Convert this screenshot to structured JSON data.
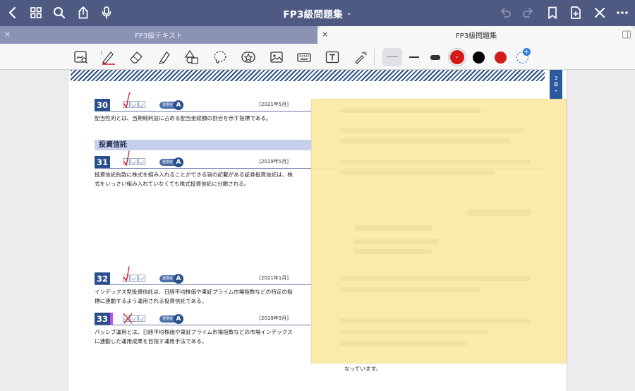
{
  "navbar": {
    "title": "FP3級問題集",
    "title_chevron": "⌄"
  },
  "tabs": [
    {
      "label": "FP3級テキスト",
      "close": "×"
    },
    {
      "label": "FP3級問題集",
      "close": "×"
    }
  ],
  "section": {
    "title": "投資信託"
  },
  "questions": [
    {
      "number": "30",
      "importance_label": "重要度",
      "grade": "A",
      "date": "[2021年5月]",
      "text": [
        "配当性向とは、当期純利益に占める配当金総額の割合を示す指標である。"
      ]
    },
    {
      "number": "31",
      "importance_label": "重要度",
      "grade": "A",
      "date": "[2019年5月]",
      "text": [
        "投資信託約款に株式を組み入れることができる旨の記載がある証券投資信託は、株",
        "式をいっさい組み入れていなくても株式投資信託に分類される。"
      ]
    },
    {
      "number": "32",
      "importance_label": "重要度",
      "grade": "A",
      "date": "[2021年1月]",
      "text": [
        "インデックス型投資信託は、日経平均株価や東証プライム市場指数などの特定の指",
        "標に連動するよう運用される投資信託である。"
      ]
    },
    {
      "number": "33",
      "importance_label": "重要度",
      "grade": "A",
      "date": "[2019年9月]",
      "text": [
        "パッシブ運用とは、日経平均株価や東証プライム市場指数などの市場インデックス",
        "に連動した運用成果を目指す運用手法である。"
      ]
    }
  ],
  "footer_text": "なっています。",
  "colors": {
    "navbar": "#4f5a82",
    "accent_blue": "#294e8d",
    "ink_red": "#d11a1a",
    "sticky": "#faeaa7",
    "highlight_purple": "#c44cf0"
  },
  "toolbar_icons": [
    "lasso-zoom-icon",
    "pen-icon",
    "eraser-icon",
    "highlighter-icon",
    "shapes-icon",
    "lasso-icon",
    "sticker-icon",
    "image-icon",
    "keyboard-icon",
    "textbox-icon",
    "laser-pointer-icon"
  ]
}
